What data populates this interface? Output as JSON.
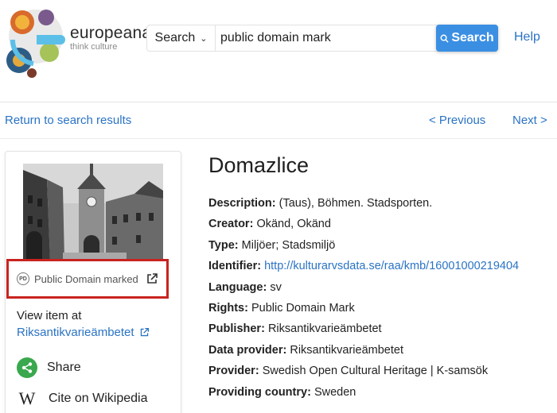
{
  "brand": {
    "name": "europeana",
    "tagline": "think culture"
  },
  "search": {
    "scope": "Search",
    "query": "public domain mark",
    "button_label": "Search"
  },
  "header": {
    "help": "Help"
  },
  "nav": {
    "return": "Return to search results",
    "previous": "< Previous",
    "next": "Next >"
  },
  "item": {
    "title": "Domazlice",
    "rights_label": "Public Domain marked",
    "rights_badge": "PD",
    "view_item_at": "View item at",
    "provider_link": "Riksantikvarieämbetet",
    "share": "Share",
    "cite": "Cite on Wikipedia",
    "wiki_glyph": "W"
  },
  "metadata": [
    {
      "label": "Description:",
      "value": "(Taus), Böhmen. Stadsporten.",
      "link": false
    },
    {
      "label": "Creator:",
      "value": "Okänd, Okänd",
      "link": false
    },
    {
      "label": "Type:",
      "value": "Miljöer; Stadsmiljö",
      "link": false
    },
    {
      "label": "Identifier:",
      "value": "http://kulturarvsdata.se/raa/kmb/16001000219404",
      "link": true
    },
    {
      "label": "Language:",
      "value": "sv",
      "link": false
    },
    {
      "label": "Rights:",
      "value": "Public Domain Mark",
      "link": false
    },
    {
      "label": "Publisher:",
      "value": "Riksantikvarieämbetet",
      "link": false
    },
    {
      "label": "Data provider:",
      "value": "Riksantikvarieämbetet",
      "link": false
    },
    {
      "label": "Provider:",
      "value": "Swedish Open Cultural Heritage | K-samsök",
      "link": false
    },
    {
      "label": "Providing country:",
      "value": "Sweden",
      "link": false
    }
  ],
  "colors": {
    "link": "#2a73c4",
    "search_button": "#3b8fe3",
    "highlight": "#c8231f",
    "share": "#3aa84e"
  }
}
